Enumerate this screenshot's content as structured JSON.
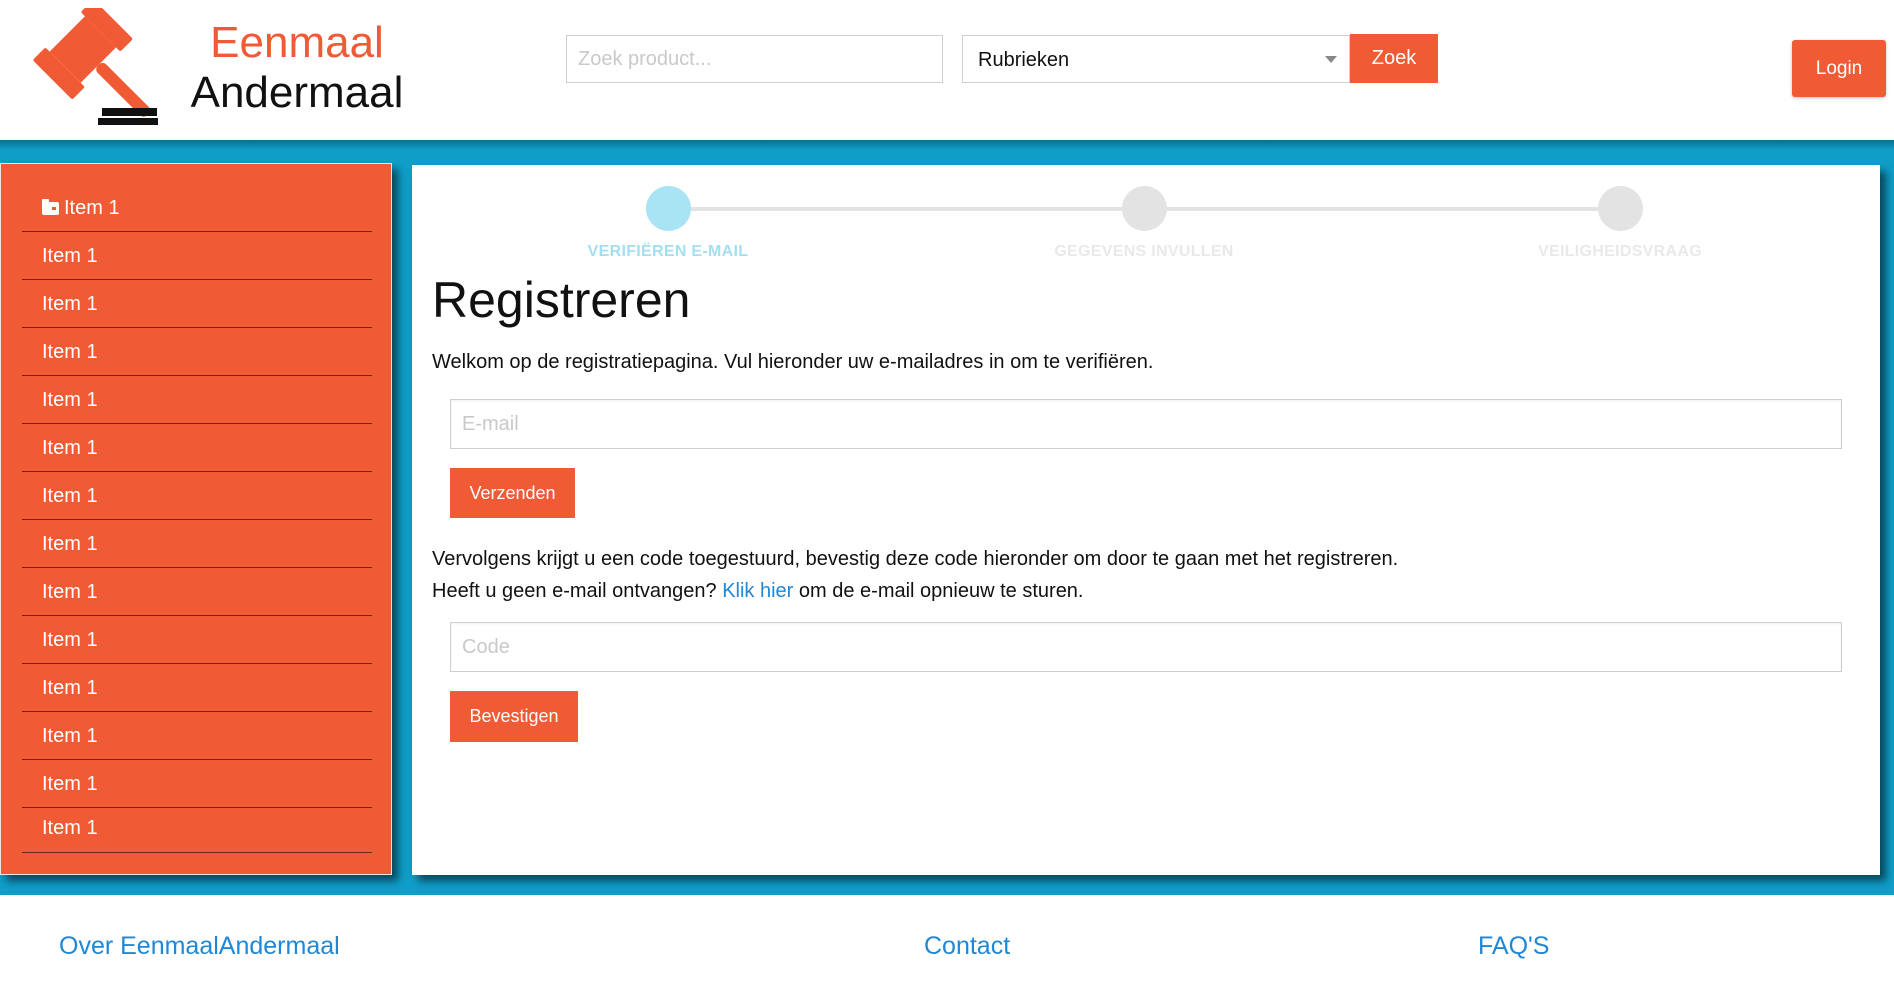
{
  "header": {
    "logo_line1": "Eenmaal",
    "logo_line2": "Andermaal",
    "search_placeholder": "Zoek product...",
    "category_select": "Rubrieken",
    "search_button": "Zoek",
    "login_button": "Login"
  },
  "sidebar": {
    "items": [
      {
        "label": "Item 1",
        "icon": "folder-icon"
      },
      {
        "label": "Item 1"
      },
      {
        "label": "Item 1"
      },
      {
        "label": "Item 1"
      },
      {
        "label": "Item 1"
      },
      {
        "label": "Item 1"
      },
      {
        "label": "Item 1"
      },
      {
        "label": "Item 1"
      },
      {
        "label": "Item 1"
      },
      {
        "label": "Item 1"
      },
      {
        "label": "Item 1"
      },
      {
        "label": "Item 1"
      },
      {
        "label": "Item 1"
      },
      {
        "label": "Item 1"
      }
    ]
  },
  "progress": {
    "steps": [
      {
        "label": "VERIFIËREN E-MAIL",
        "active": true
      },
      {
        "label": "GEGEVENS INVULLEN",
        "active": false
      },
      {
        "label": "VEILIGHEIDSVRAAG",
        "active": false
      }
    ]
  },
  "main": {
    "title": "Registreren",
    "intro": "Welkom op de registratiepagina. Vul hieronder uw e-mailadres in om te verifiëren.",
    "email_placeholder": "E-mail",
    "send_button": "Verzenden",
    "followup_line1": "Vervolgens krijgt u een code toegestuurd, bevestig deze code hieronder om door te gaan met het registreren.",
    "followup_line2_before": "Heeft u geen e-mail ontvangen? ",
    "resend_link": "Klik hier",
    "followup_line2_after": " om de e-mail opnieuw te sturen.",
    "code_placeholder": "Code",
    "confirm_button": "Bevestigen"
  },
  "footer": {
    "links": [
      "Over EenmaalAndermaal",
      "Contact",
      "FAQ'S"
    ]
  },
  "colors": {
    "accent": "#f05a35",
    "band": "#0f9ec8",
    "link": "#1e88d6",
    "step_active": "#a8e4f4"
  }
}
